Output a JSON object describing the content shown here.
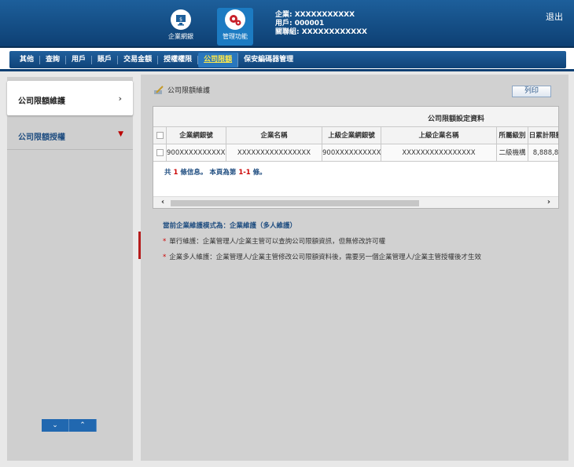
{
  "header": {
    "btn_portal": "企業網銀",
    "btn_manage": "管理功能",
    "company_line": "企業: XXXXXXXXXXX",
    "user_line": "用戶: 000001",
    "group_line": "關聯組: XXXXXXXXXXXX",
    "logout": "退出"
  },
  "nav": {
    "items": [
      "其他",
      "查詢",
      "用戶",
      "賬戶",
      "交易金額",
      "授權權限",
      "公司限額",
      "保安編碼器管理"
    ],
    "active_index": 6
  },
  "sidebar": {
    "item1": "公司限額維護",
    "item2": "公司限額授權"
  },
  "page": {
    "title": "公司限額維護",
    "print": "列印",
    "group_header": "公司限額設定資料",
    "columns": [
      "企業網銀號",
      "企業名稱",
      "上級企業網銀號",
      "上級企業名稱",
      "所屬級別",
      "日累計限額"
    ],
    "row": [
      "900XXXXXXXXXXX",
      "XXXXXXXXXXXXXXXX",
      "900XXXXXXXXXXX",
      "XXXXXXXXXXXXXXXX",
      "二級機構",
      "8,888,8"
    ],
    "summary_pre": "共",
    "summary_count": "1",
    "summary_mid": "條信息。 本頁為第",
    "summary_range": "1-1",
    "summary_post": "條。",
    "mode_line": "當前企業維護模式為：企業維護（多人維護）",
    "note1": "單行維護：企業管理人/企業主管可以查詢公司限額資訊，但無修改許可權",
    "note2": "企業多人維護：企業管理人/企業主管修改公司限額資料後，需要另一個企業管理人/企業主管授權後才生效"
  },
  "colors": {
    "header_blue": "#0d3f72",
    "accent_red": "#b51d1d",
    "link_blue": "#1f4d80"
  }
}
